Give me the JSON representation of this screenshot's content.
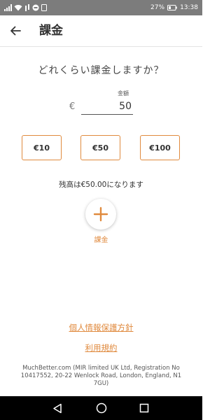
{
  "status_bar": {
    "battery": "27%",
    "time": "13:38"
  },
  "app_bar": {
    "title": "課金"
  },
  "charge": {
    "question": "どれくらい課金しますか？",
    "amount_label": "金額",
    "currency": "€",
    "amount_value": "50",
    "presets": [
      "€10",
      "€50",
      "€100"
    ],
    "balance_text": "残高は€50.00になります",
    "charge_button_label": "課金"
  },
  "links": {
    "privacy": "個人情報保護方針",
    "terms": "利用規約"
  },
  "footer": {
    "text": "MuchBetter.com (MIR limited UK Ltd, Registration No 10417552, 20-22 Wenlock Road, London, England, N1 7GU)"
  },
  "colors": {
    "accent": "#e08a3e",
    "status_bar": "#7c7c7c",
    "nav_bar": "#000000"
  }
}
